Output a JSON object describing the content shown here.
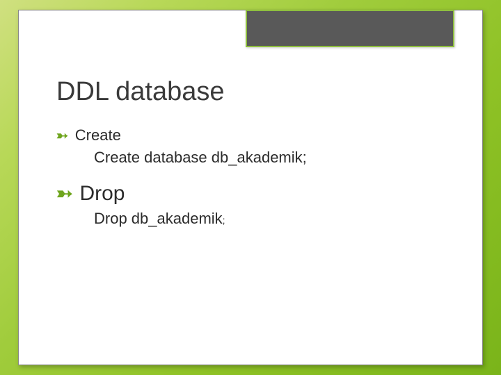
{
  "slide": {
    "title": "DDL database",
    "bullets": [
      {
        "size": "sm",
        "text": "Create"
      },
      {
        "size": "lg",
        "text": "Drop"
      }
    ],
    "code": {
      "create": "Create database db_akademik;",
      "drop_main": "Drop db_akademik",
      "drop_semi": ";"
    }
  }
}
